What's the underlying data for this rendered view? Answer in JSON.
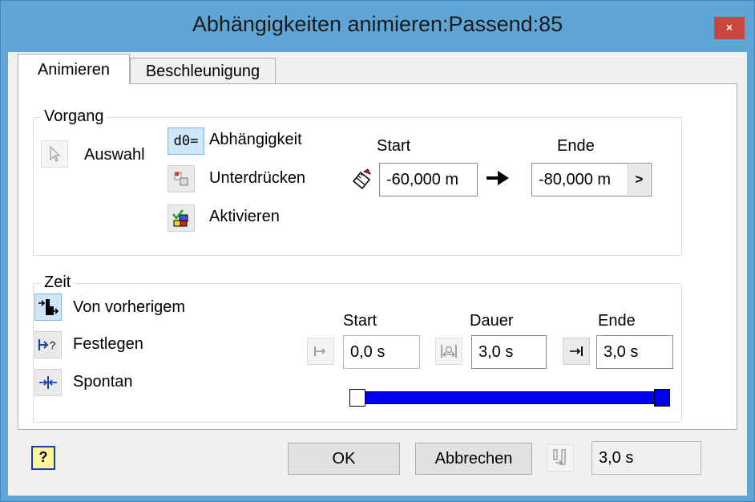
{
  "window": {
    "title": "Abhängigkeiten animieren:Passend:85",
    "close_glyph": "×"
  },
  "tabs": [
    {
      "label": "Animieren"
    },
    {
      "label": "Beschleunigung"
    }
  ],
  "vorgang": {
    "legend": "Vorgang",
    "auswahl_label": "Auswahl",
    "abhaengigkeit_icon_text": "d0=",
    "abhaengigkeit_label": "Abhängigkeit",
    "unterdruecken_label": "Unterdrücken",
    "aktivieren_label": "Aktivieren",
    "start_label": "Start",
    "ende_label": "Ende",
    "start_value": "-60,000 m",
    "ende_value": "-80,000 m",
    "expand_glyph": ">"
  },
  "zeit": {
    "legend": "Zeit",
    "von_vorherigem_label": "Von vorherigem",
    "festlegen_label": "Festlegen",
    "spontan_label": "Spontan",
    "start_label": "Start",
    "dauer_label": "Dauer",
    "ende_label": "Ende",
    "start_value": "0,0 s",
    "dauer_value": "3,0 s",
    "ende_value": "3,0 s",
    "slider": {
      "start_fraction": 0.0,
      "end_fraction": 1.0,
      "fill_color": "#0000f0",
      "end_thumb_color": "#0000f0"
    }
  },
  "footer": {
    "help_glyph": "?",
    "ok_label": "OK",
    "cancel_label": "Abbrechen",
    "duration_value": "3,0 s"
  },
  "colors": {
    "titlebar": "#5fa5d6",
    "close": "#c9473d",
    "selected": "#cde6f8"
  }
}
